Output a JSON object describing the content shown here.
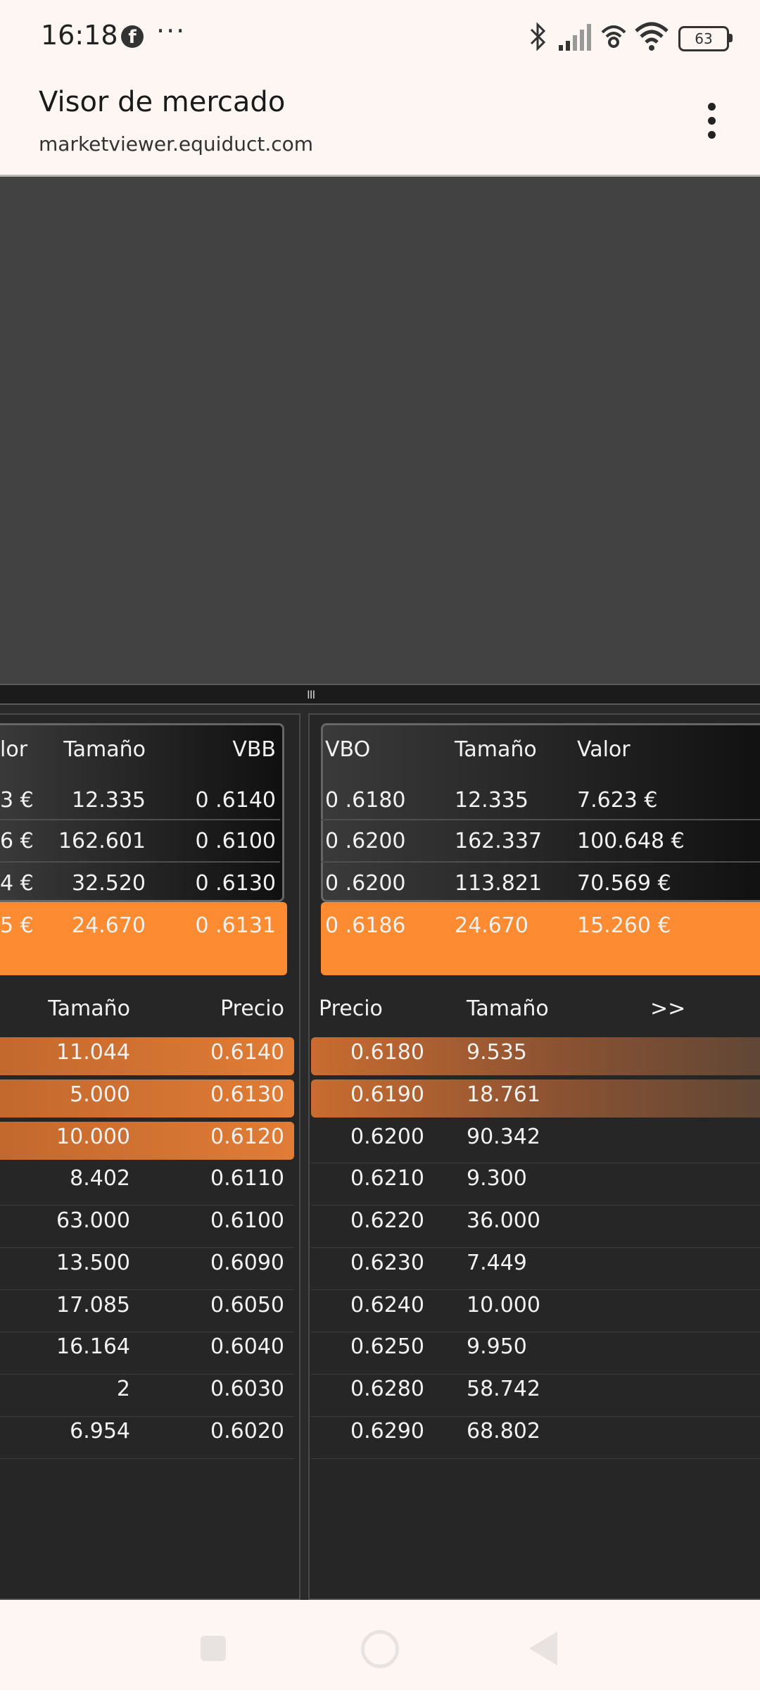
{
  "status_bar": {
    "time": "16:18",
    "overflow": "···",
    "battery": "63",
    "icons": [
      "facebook-icon",
      "bluetooth-icon",
      "signal-icon",
      "hotspot-icon",
      "wifi-icon",
      "battery-icon"
    ]
  },
  "browser": {
    "title": "Visor de mercado",
    "url": "marketviewer.equiduct.com"
  },
  "splitter_grip": "III",
  "summary_left": {
    "headers": [
      "lor",
      "Tamaño",
      "VBB"
    ],
    "rows": [
      {
        "valor": "3 €",
        "tamano": "12.335",
        "vbb": "0 .6140"
      },
      {
        "valor": "6 €",
        "tamano": "162.601",
        "vbb": "0 .6100"
      },
      {
        "valor": "4 €",
        "tamano": "32.520",
        "vbb": "0 .6130"
      },
      {
        "valor": "5 €",
        "tamano": "24.670",
        "vbb": "0 .6131"
      }
    ]
  },
  "summary_right": {
    "headers": [
      "VBO",
      "Tamaño",
      "Valor"
    ],
    "rows": [
      {
        "vbo": "0 .6180",
        "tamano": "12.335",
        "valor": "7.623 €"
      },
      {
        "vbo": "0 .6200",
        "tamano": "162.337",
        "valor": "100.648 €"
      },
      {
        "vbo": "0 .6200",
        "tamano": "113.821",
        "valor": "70.569 €"
      },
      {
        "vbo": "0 .6186",
        "tamano": "24.670",
        "valor": "15.260 €"
      }
    ]
  },
  "bids": {
    "headers": [
      "Tamaño",
      "Precio"
    ],
    "rows": [
      {
        "tamano": "11.044",
        "precio": "0.6140"
      },
      {
        "tamano": "5.000",
        "precio": "0.6130"
      },
      {
        "tamano": "10.000",
        "precio": "0.6120"
      },
      {
        "tamano": "8.402",
        "precio": "0.6110"
      },
      {
        "tamano": "63.000",
        "precio": "0.6100"
      },
      {
        "tamano": "13.500",
        "precio": "0.6090"
      },
      {
        "tamano": "17.085",
        "precio": "0.6050"
      },
      {
        "tamano": "16.164",
        "precio": "0.6040"
      },
      {
        "tamano": "2",
        "precio": "0.6030"
      },
      {
        "tamano": "6.954",
        "precio": "0.6020"
      }
    ]
  },
  "asks": {
    "headers": [
      "Precio",
      "Tamaño",
      ">>"
    ],
    "rows": [
      {
        "precio": "0.6180",
        "tamano": "9.535"
      },
      {
        "precio": "0.6190",
        "tamano": "18.761"
      },
      {
        "precio": "0.6200",
        "tamano": "90.342"
      },
      {
        "precio": "0.6210",
        "tamano": "9.300"
      },
      {
        "precio": "0.6220",
        "tamano": "36.000"
      },
      {
        "precio": "0.6230",
        "tamano": "7.449"
      },
      {
        "precio": "0.6240",
        "tamano": "10.000"
      },
      {
        "precio": "0.6250",
        "tamano": "9.950"
      },
      {
        "precio": "0.6280",
        "tamano": "58.742"
      },
      {
        "precio": "0.6290",
        "tamano": "68.802"
      }
    ]
  }
}
